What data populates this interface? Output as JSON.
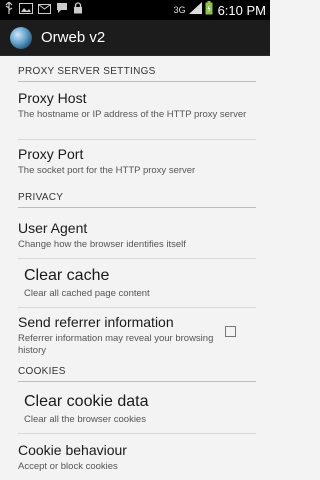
{
  "status_bar": {
    "network": "3G",
    "time": "6:10 PM",
    "icons": [
      "usb-icon",
      "picture-icon",
      "email-icon",
      "chat-icon",
      "lock-icon",
      "signal-icon",
      "battery-icon"
    ]
  },
  "action_bar": {
    "title": "Orweb v2",
    "icon": "orweb-globe-icon"
  },
  "sections": {
    "proxy": "PROXY SERVER SETTINGS",
    "privacy": "PRIVACY",
    "cookies": "COOKIES"
  },
  "prefs": {
    "proxy_host": {
      "title": "Proxy Host",
      "summary": "The hostname or IP address of the HTTP proxy server"
    },
    "proxy_port": {
      "title": "Proxy Port",
      "summary": "The socket port for the HTTP proxy server"
    },
    "user_agent": {
      "title": "User Agent",
      "summary": "Change how the browser identifies itself"
    },
    "clear_cache": {
      "title": "Clear cache",
      "summary": "Clear all cached page content"
    },
    "referrer": {
      "title": "Send referrer information",
      "summary": "Referrer information may reveal your browsing history",
      "checked": false
    },
    "clear_cookies": {
      "title": "Clear cookie data",
      "summary": "Clear all the browser cookies"
    },
    "cookie_behaviour": {
      "title": "Cookie behaviour",
      "summary": "Accept or block cookies"
    }
  },
  "colors": {
    "status_bar": "#000000",
    "action_bar": "#1c1c1c",
    "background": "#f3f3f3",
    "battery": "#8bc34a"
  }
}
